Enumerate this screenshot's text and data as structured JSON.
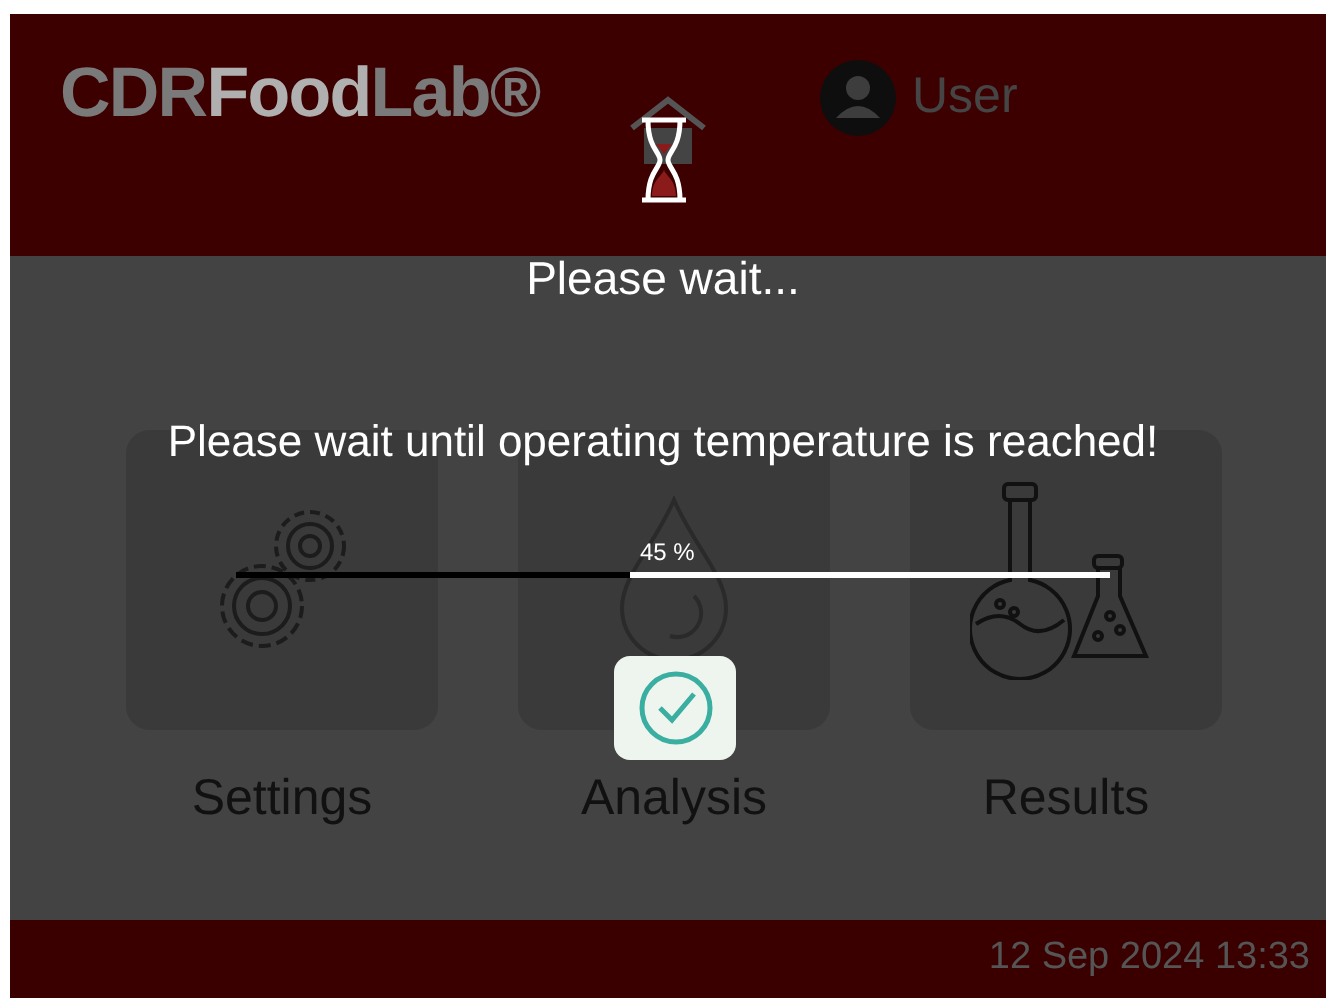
{
  "header": {
    "logo": [
      {
        "text": "CDR",
        "kind": "dark"
      },
      {
        "text": "Food",
        "kind": "light"
      },
      {
        "text": "Lab®",
        "kind": "dark"
      }
    ],
    "user": {
      "label": "User"
    }
  },
  "tiles": [
    {
      "label": "Settings",
      "kind": "gears"
    },
    {
      "label": "Analysis",
      "kind": "drop"
    },
    {
      "label": "Results",
      "kind": "flasks"
    }
  ],
  "dialog": {
    "title": "Please wait...",
    "message": "Please wait until operating temperature is reached!",
    "progress": {
      "level": 0.45,
      "reading": "45 %"
    }
  },
  "status_bar": {
    "datetime": "12 Sep 2024 13:33"
  }
}
